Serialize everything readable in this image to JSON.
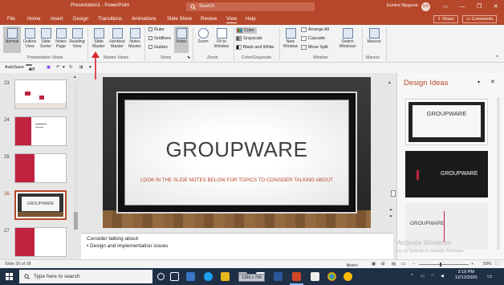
{
  "titlebar": {
    "title": "Presentation1 - PowerPoint",
    "search_placeholder": "Search",
    "user_name": "Eunice Njuguna",
    "user_initials": "EN",
    "minimize": "—",
    "restore": "❐",
    "close": "✕"
  },
  "tabs": [
    "File",
    "Home",
    "Insert",
    "Design",
    "Transitions",
    "Animations",
    "Slide Show",
    "Review",
    "View",
    "Help"
  ],
  "active_tab": "View",
  "share_label": "Share",
  "comments_label": "Comments",
  "ribbon": {
    "presentation_views": {
      "label": "Presentation Views",
      "buttons": [
        "Normal",
        "Outline\nView",
        "Slide\nSorter",
        "Notes\nPage",
        "Reading\nView"
      ]
    },
    "master_views": {
      "label": "Master Views",
      "buttons": [
        "Slide\nMaster",
        "Handout\nMaster",
        "Notes\nMaster"
      ]
    },
    "show": {
      "label": "Show",
      "checks": [
        "Ruler",
        "Gridlines",
        "Guides"
      ],
      "notes_button": "Notes"
    },
    "zoom": {
      "label": "Zoom",
      "buttons": [
        "Zoom",
        "Fit to\nWindow"
      ]
    },
    "color": {
      "label": "Color/Grayscale",
      "items": [
        "Color",
        "Grayscale",
        "Black and White"
      ]
    },
    "window": {
      "label": "Window",
      "new_window": "New\nWindow",
      "items": [
        "Arrange All",
        "Cascade",
        "Move Split"
      ],
      "switch": "Switch\nWindows"
    },
    "macros": {
      "label": "Macros",
      "button": "Macros"
    }
  },
  "qat": {
    "autosave_label": "AutoSave",
    "autosave_state": "Off"
  },
  "thumbnails": [
    {
      "number": "23"
    },
    {
      "number": "24"
    },
    {
      "number": "25"
    },
    {
      "number": "26",
      "title": "GROUPWARE"
    },
    {
      "number": "27"
    }
  ],
  "active_slide": "26",
  "slide": {
    "title": "GROUPWARE",
    "subtitle": "LOOK IN THE SLIDE NOTES BELOW FOR TOPICS TO CONSIDER TALKING ABOUT"
  },
  "notes": {
    "line1": "Consider talking about:",
    "line2": "•   Design and implementation issues"
  },
  "design_pane": {
    "title": "Design Ideas",
    "ideas": [
      "GROUPWARE",
      "GROUPWARE",
      "GROUPWARE"
    ],
    "watermark_title": "Activate Windows",
    "watermark_sub": "Go to Settings to activate Windows."
  },
  "status": {
    "slide_info": "Slide 26 of 28",
    "notes_label": "Notes",
    "zoom_value": "58%"
  },
  "taskbar": {
    "search_placeholder": "Type here to search",
    "tooltip": "1366 x 768",
    "time": "3:19 PM",
    "date": "12/12/2020"
  },
  "colors": {
    "accent": "#b7472a",
    "taskbar": "#1e2f46"
  }
}
